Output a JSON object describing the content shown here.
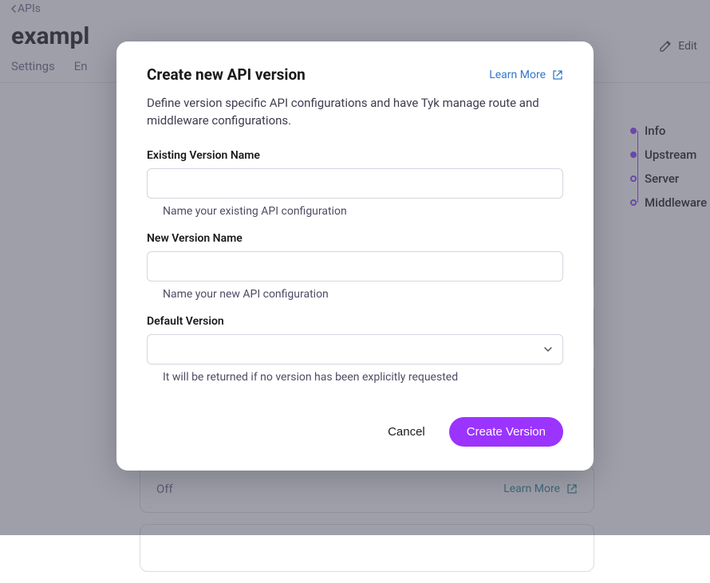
{
  "breadcrumb": {
    "back": "APIs"
  },
  "header": {
    "title": "exampl",
    "edit": "Edit"
  },
  "tabs": [
    {
      "label": "Settings"
    },
    {
      "label": "En"
    }
  ],
  "sidenav": [
    {
      "label": "Info",
      "active": true
    },
    {
      "label": "Upstream",
      "active": true
    },
    {
      "label": "Server",
      "active": false
    },
    {
      "label": "Middleware",
      "active": false
    }
  ],
  "cards": {
    "off": "Off",
    "learn": "Learn More"
  },
  "modal": {
    "title": "Create new API version",
    "learn": "Learn More",
    "desc": "Define version specific API configurations and have Tyk manage route and middleware configurations.",
    "existing_label": "Existing Version Name",
    "existing_hint": "Name your existing API configuration",
    "new_label": "New Version Name",
    "new_hint": "Name your new API configuration",
    "default_label": "Default Version",
    "default_hint": "It will be returned if no version has been explicitly requested",
    "cancel": "Cancel",
    "create": "Create Version"
  }
}
